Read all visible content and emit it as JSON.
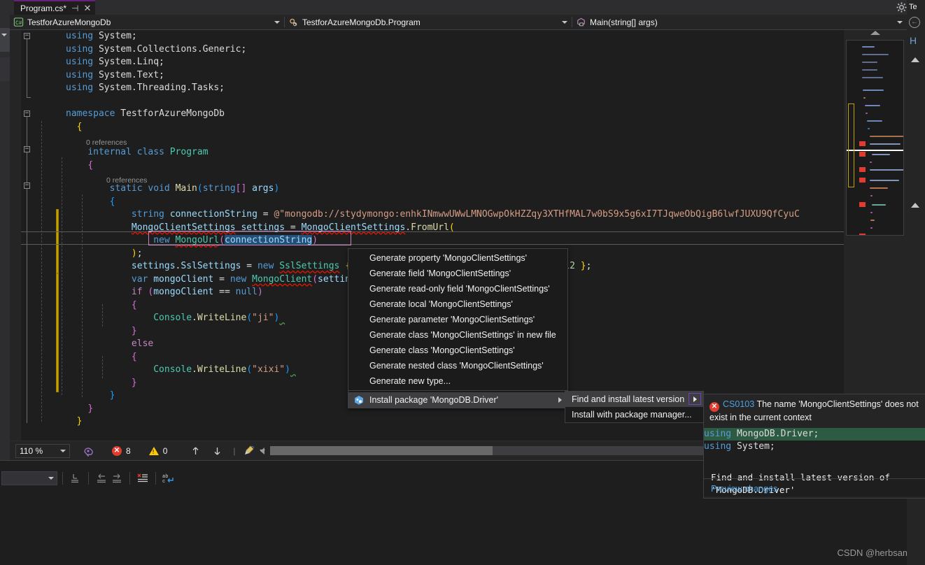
{
  "window": {
    "tab": {
      "title": "Program.cs*",
      "pin_icon": "pin-icon",
      "close_icon": "close-icon"
    },
    "vs_label": "Te",
    "gear_icon": "gear-icon"
  },
  "navbar": {
    "project": "TestforAzureMongoDb",
    "project_icon": "csharp-file-icon",
    "type": "TestforAzureMongoDb.Program",
    "type_icon": "class-icon",
    "member": "Main(string[] args)",
    "member_icon": "method-icon",
    "dropdown_icon": "chevron-down-icon"
  },
  "code": {
    "lines": [
      "using System;",
      "using System.Collections.Generic;",
      "using System.Linq;",
      "using System.Text;",
      "using System.Threading.Tasks;",
      "",
      "namespace TestforAzureMongoDb",
      "{",
      "    internal class Program",
      "    {",
      "        static void Main(string[] args)",
      "        {",
      "            string connectionString = @\"mongodb://stydymongo:enhkINmwwUWwLMNOGwpOkHZZqy3XTHfMAL7w0bS9x5g6xI7TJqweObQigB6lwfJUXU9QfCyuC",
      "            MongoClientSettings settings = MongoClientSettings.FromUrl(",
      "                new MongoUrl(connectionString)",
      "            );",
      "            settings.SslSettings = new SslSettings { EnabledSslProtocols = SslProtocols.Tls12 };",
      "            var mongoClient = new MongoClient(settings);",
      "            if (mongoClient == null)",
      "            {",
      "                Console.WriteLine(\"ji\")",
      "            }",
      "            else",
      "            {",
      "                Console.WriteLine(\"xixi\")",
      "            }",
      "        }",
      "    }",
      "}"
    ],
    "codelens": {
      "class_refs": "0 references",
      "method_refs": "0 references"
    },
    "tokens": {
      "using": "using",
      "system": "System;",
      "system_collections": "System.Collections.Generic;",
      "system_linq": "System.Linq;",
      "system_text": "System.Text;",
      "system_threading": "System.Threading.Tasks;",
      "namespace_kw": "namespace",
      "namespace_name": "TestforAzureMongoDb",
      "internal": "internal",
      "class_kw": "class",
      "class_name": "Program",
      "static": "static",
      "void": "void",
      "main": "Main",
      "string_kw": "string",
      "args": "args",
      "connection_var": "connectionString",
      "conn_value": "@\"mongodb://stydymongo:enhkINmwwUWwLMNOGwpOkHZZqy3XTHfMAL7w0bS9x5g6xI7TJqweObQigB6lwfJUXU9QfCyuC",
      "mcs_type": "MongoClientSettings",
      "settings_var": "settings",
      "fromurl": "FromUrl",
      "new_kw": "new",
      "mongourl": "MongoUrl",
      "sslsettings_prop": "SslSettings",
      "sslsettings_type": "SslSettings",
      "tls_tail": "cols.Tls12 };",
      "var_kw": "var",
      "mongoclient_var": "mongoClient",
      "mongoclient_type": "MongoClient",
      "if_kw": "if",
      "null_kw": "null",
      "else_kw": "else",
      "console": "Console",
      "writeline": "WriteLine",
      "ji": "\"ji\"",
      "xixi": "\"xixi\""
    }
  },
  "lightbulb": {
    "icon": "lightbulb-icon",
    "caret": "chevron-down-icon"
  },
  "context_menu": {
    "items": [
      {
        "label": "Generate property 'MongoClientSettings'",
        "highlighted": false,
        "icon": null,
        "submenu": false
      },
      {
        "label": "Generate field 'MongoClientSettings'",
        "highlighted": false,
        "icon": null,
        "submenu": false
      },
      {
        "label": "Generate read-only field 'MongoClientSettings'",
        "highlighted": false,
        "icon": null,
        "submenu": false
      },
      {
        "label": "Generate local 'MongoClientSettings'",
        "highlighted": false,
        "icon": null,
        "submenu": false
      },
      {
        "label": "Generate parameter 'MongoClientSettings'",
        "highlighted": false,
        "icon": null,
        "submenu": false
      },
      {
        "label": "Generate class 'MongoClientSettings' in new file",
        "highlighted": false,
        "icon": null,
        "submenu": false
      },
      {
        "label": "Generate class 'MongoClientSettings'",
        "highlighted": false,
        "icon": null,
        "submenu": false
      },
      {
        "label": "Generate nested class 'MongoClientSettings'",
        "highlighted": false,
        "icon": null,
        "submenu": false
      },
      {
        "label": "Generate new type...",
        "highlighted": false,
        "icon": null,
        "submenu": false
      },
      {
        "label": "Install package 'MongoDB.Driver'",
        "highlighted": true,
        "icon": "nuget-package-icon",
        "submenu": true
      }
    ]
  },
  "submenu": {
    "items": [
      {
        "label": "Find and install latest version",
        "highlighted": true,
        "submenu": true
      },
      {
        "label": "Install with package manager...",
        "highlighted": false,
        "submenu": false
      }
    ]
  },
  "preview": {
    "error_icon": "error-icon",
    "error_code": "CS0103",
    "error_text": "The name 'MongoClientSettings' does not exist in the current context",
    "added_line": "using MongoDB.Driver;",
    "existing_line": "using System;",
    "note": "Find and install latest version of 'MongoDB.Driver'",
    "link": "Preview changes"
  },
  "status_bar": {
    "zoom": "110 %",
    "zoom_caret_icon": "chevron-down-icon",
    "speech_icon": "intellicode-icon",
    "error_count": "8",
    "error_icon": "error-circle-icon",
    "warning_count": "0",
    "warning_icon": "warning-triangle-icon",
    "up_icon": "arrow-up-icon",
    "down_icon": "arrow-down-icon",
    "broom_icon": "code-cleanup-icon",
    "broom_caret_icon": "chevron-down-icon",
    "hscroll_left_icon": "scroll-left-icon"
  },
  "bottom_panel": {
    "combo_caret_icon": "chevron-down-icon",
    "buttons": [
      {
        "name": "go-to-definition-icon"
      },
      {
        "name": "navigate-backward-icon"
      },
      {
        "name": "navigate-forward-icon"
      },
      {
        "name": "clear-all-icon"
      },
      {
        "name": "word-wrap-icon"
      }
    ]
  },
  "right_panel": {
    "title": "Te",
    "back_icon": "back-arrow-icon",
    "heading": "H",
    "expander_icon": "triangle-up-icon"
  },
  "minimap": {
    "scroll_up_icon": "scroll-up-icon",
    "error_marker_color": "#e03c31",
    "viewport_color": "#c3a000"
  },
  "watermark": "CSDN @herbsama",
  "colors": {
    "accent": "#68217a",
    "editor_bg": "#1e1e1e",
    "chrome_bg": "#2d2d30",
    "error": "#e03c31",
    "added_bg": "#2d5a42",
    "link": "#4ea1e0"
  }
}
